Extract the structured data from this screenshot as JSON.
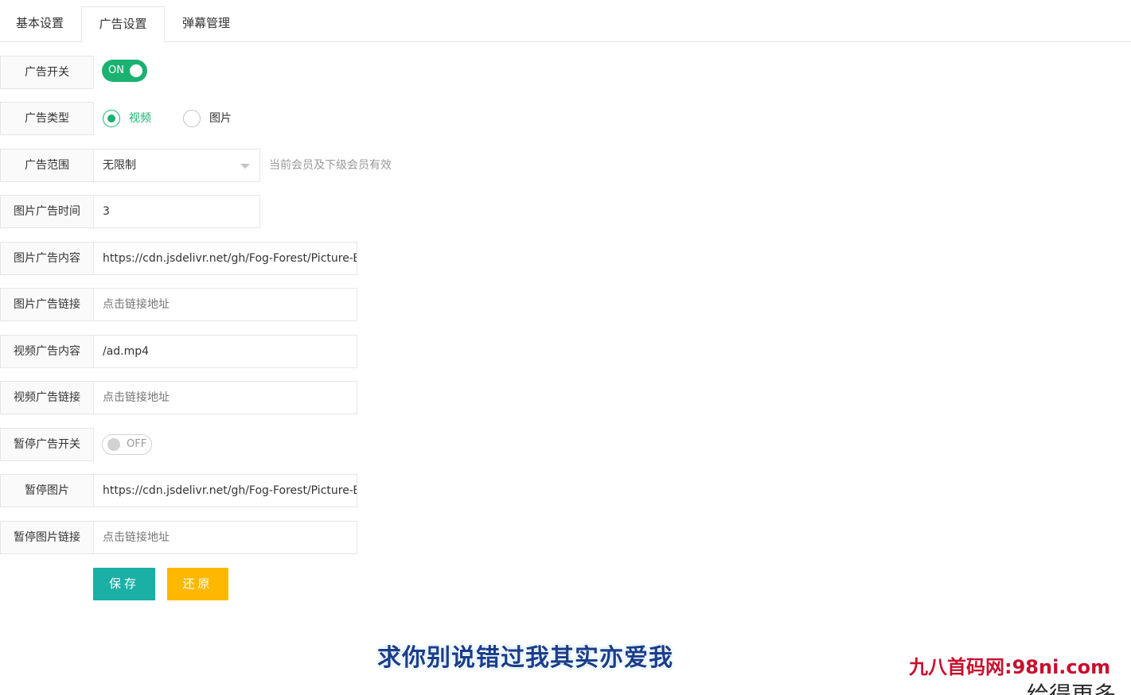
{
  "tabs": [
    "基本设置",
    "广告设置",
    "弹幕管理"
  ],
  "form": {
    "ad_switch": {
      "label": "广告开关",
      "state": "ON"
    },
    "ad_type": {
      "label": "广告类型",
      "options": [
        "视频",
        "图片"
      ],
      "selected": "视频"
    },
    "ad_scope": {
      "label": "广告范围",
      "value": "无限制",
      "hint": "当前会员及下级会员有效"
    },
    "img_ad_time": {
      "label": "图片广告时间",
      "value": "3"
    },
    "img_ad_content": {
      "label": "图片广告内容",
      "value": "https://cdn.jsdelivr.net/gh/Fog-Forest/Picture-B"
    },
    "img_ad_link": {
      "label": "图片广告链接",
      "placeholder": "点击链接地址"
    },
    "video_ad_content": {
      "label": "视频广告内容",
      "value": "/ad.mp4"
    },
    "video_ad_link": {
      "label": "视频广告链接",
      "placeholder": "点击链接地址"
    },
    "pause_ad_switch": {
      "label": "暂停广告开关",
      "state": "OFF"
    },
    "pause_img": {
      "label": "暂停图片",
      "value": "https://cdn.jsdelivr.net/gh/Fog-Forest/Picture-B"
    },
    "pause_img_link": {
      "label": "暂停图片链接",
      "placeholder": "点击链接地址"
    }
  },
  "buttons": {
    "save": "保存",
    "reset": "还原"
  },
  "overlay": {
    "subtitle": "求你别说错过我其实亦爱我",
    "watermark": "九八首码网:98ni.com",
    "corner": "给得更多"
  },
  "colors": {
    "accent": "#1ab171",
    "save": "#1ab0a5",
    "reset": "#ffb800"
  }
}
